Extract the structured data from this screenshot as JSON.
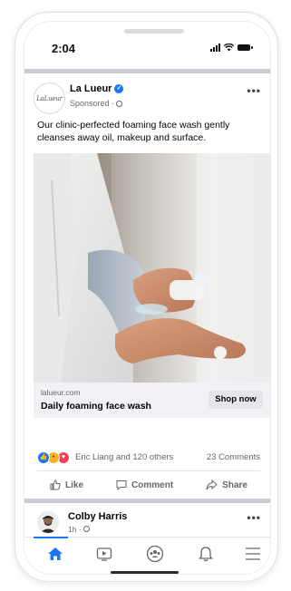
{
  "status_bar": {
    "time": "2:04"
  },
  "post": {
    "logo_text": "LaLueur",
    "brand_name": "La Lueur",
    "sponsored_label": "Sponsored · ",
    "more_icon": "more-horizontal-icon",
    "caption": "Our clinic-perfected foaming face wash gently cleanses away oil, makeup and surface.",
    "link": {
      "domain": "lalueur.com",
      "headline": "Daily foaming face wash",
      "cta": "Shop now"
    },
    "reactions": {
      "names": "Eric Liang and 120 others",
      "comments": "23 Comments"
    },
    "actions": {
      "like": "Like",
      "comment": "Comment",
      "share": "Share"
    }
  },
  "next_post": {
    "name": "Colby Harris",
    "meta": "1h · "
  },
  "tabbar": {
    "items": [
      "home-icon",
      "video-icon",
      "groups-icon",
      "notifications-icon",
      "menu-icon"
    ]
  },
  "colors": {
    "accent": "#1877f2",
    "secondary_text": "#65676b",
    "link_bar": "#f0f2f5"
  }
}
